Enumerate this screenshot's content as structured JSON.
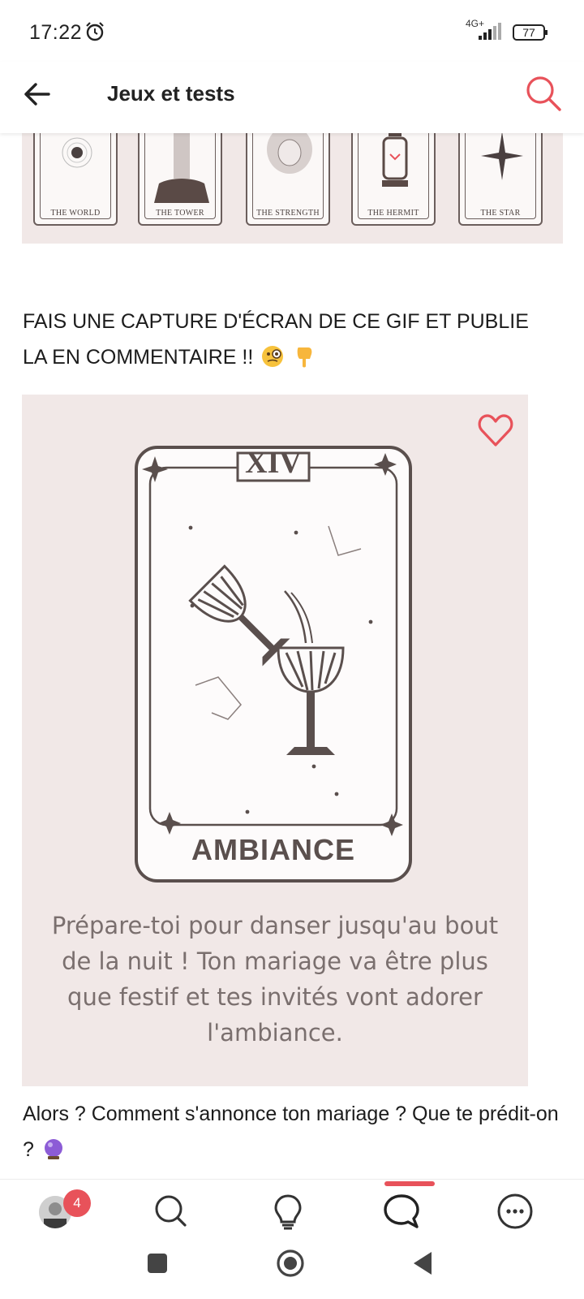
{
  "status_bar": {
    "time": "17:22",
    "network": "4G+",
    "battery": "77"
  },
  "header": {
    "title": "Jeux et tests"
  },
  "tarot_strip": {
    "cards": [
      {
        "label": "THE WORLD"
      },
      {
        "label": "THE TOWER"
      },
      {
        "label": "THE STRENGTH"
      },
      {
        "label": "THE HERMIT"
      },
      {
        "label": "THE STAR"
      }
    ]
  },
  "post": {
    "heading": "FAIS UNE CAPTURE D'ÉCRAN DE CE GIF ET PUBLIE LA EN COMMENTAIRE !!",
    "card": {
      "numeral": "XIV",
      "name": "AMBIANCE",
      "text": "Prépare-toi pour danser jusqu'au bout de la nuit ! Ton mariage va être plus que festif et tes invités vont adorer l'ambiance."
    },
    "question": "Alors ? Comment s'annonce ton mariage ? Que te prédit-on ?"
  },
  "bottom_nav": {
    "badge_count": "4",
    "active_index": 3
  },
  "colors": {
    "accent": "#e8525a",
    "panel_bg": "#f1e8e7",
    "card_ink": "#5a4f4d"
  }
}
